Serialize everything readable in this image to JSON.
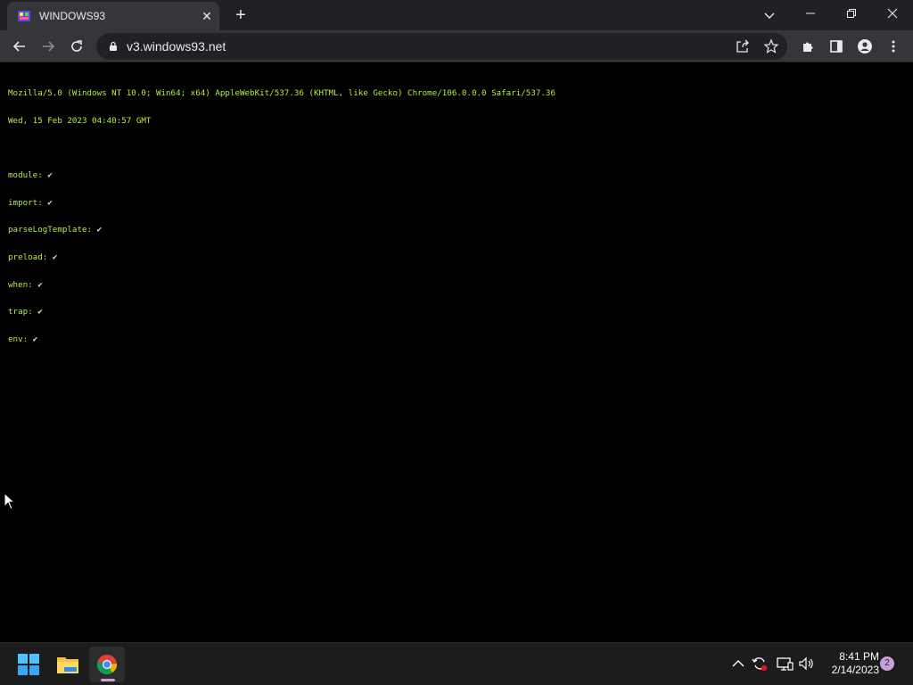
{
  "browser": {
    "tab": {
      "title": "WINDOWS93",
      "close": "✕"
    },
    "new_tab": "+",
    "address": {
      "url": "v3.windows93.net"
    }
  },
  "page": {
    "user_agent": "Mozilla/5.0 (Windows NT 10.0; Win64; x64) AppleWebKit/537.36 (KHTML, like Gecko) Chrome/106.0.0.0 Safari/537.36",
    "date": "Wed, 15 Feb 2023 04:40:57 GMT",
    "checks": [
      {
        "name": "module:",
        "mark": "✔"
      },
      {
        "name": "import:",
        "mark": "✔"
      },
      {
        "name": "parseLogTemplate:",
        "mark": "✔"
      },
      {
        "name": "preload:",
        "mark": "✔"
      },
      {
        "name": "when:",
        "mark": "✔"
      },
      {
        "name": "trap:",
        "mark": "✔"
      },
      {
        "name": "env:",
        "mark": "✔"
      }
    ]
  },
  "taskbar": {
    "apps": [
      "start-icon",
      "file-explorer-icon",
      "chrome-icon"
    ],
    "clock": {
      "time": "8:41 PM",
      "date": "2/14/2023"
    },
    "notification_count": "2"
  },
  "colors": {
    "terminal_text": "#b6f03a",
    "page_background": "#000000",
    "chrome_frame": "#202124",
    "chrome_toolbar": "#35363a",
    "accent": "#c9a0dc"
  }
}
